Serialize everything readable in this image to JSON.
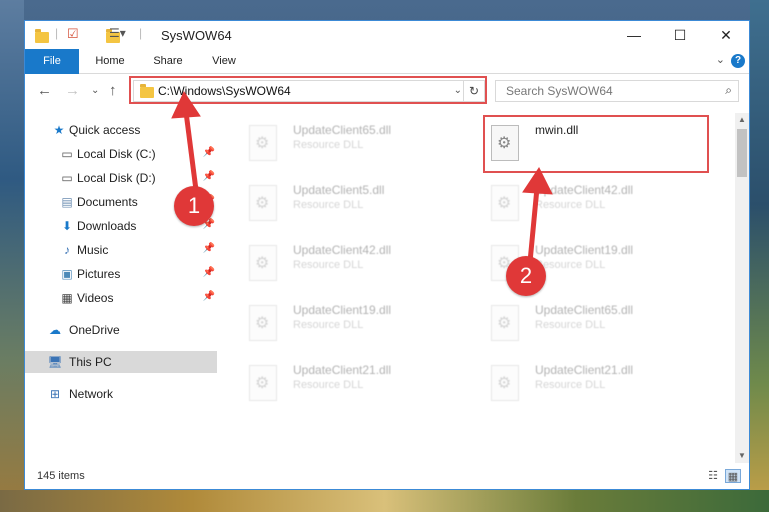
{
  "window": {
    "title": "SysWOW64",
    "controls": {
      "minimize": "—",
      "maximize": "☐",
      "close": "✕"
    }
  },
  "ribbon": {
    "tabs": [
      "File",
      "Home",
      "Share",
      "View"
    ],
    "help": "?"
  },
  "address": {
    "path": "C:\\Windows\\SysWOW64",
    "search_placeholder": "Search SysWOW64"
  },
  "nav": {
    "items": [
      {
        "label": "Quick access",
        "icon": "star-icon"
      },
      {
        "label": "Local Disk (C:)",
        "icon": "drive-icon",
        "pinned": true
      },
      {
        "label": "Local Disk (D:)",
        "icon": "drive-icon",
        "pinned": true
      },
      {
        "label": "Documents",
        "icon": "documents-icon",
        "pinned": true
      },
      {
        "label": "Downloads",
        "icon": "downloads-icon",
        "pinned": true
      },
      {
        "label": "Music",
        "icon": "music-icon",
        "pinned": true
      },
      {
        "label": "Pictures",
        "icon": "pictures-icon",
        "pinned": true
      },
      {
        "label": "Videos",
        "icon": "videos-icon",
        "pinned": true
      },
      {
        "label": "OneDrive",
        "icon": "cloud-icon"
      },
      {
        "label": "This PC",
        "icon": "computer-icon",
        "selected": true
      },
      {
        "label": "Network",
        "icon": "network-icon"
      }
    ]
  },
  "files": [
    {
      "name": "UpdateClient65.dll",
      "desc": "Resource DLL"
    },
    {
      "name": "mwin.dll",
      "desc": ""
    },
    {
      "name": "UpdateClient5.dll",
      "desc": "Resource DLL"
    },
    {
      "name": "UpdateClient42.dll",
      "desc": "Resource DLL"
    },
    {
      "name": "UpdateClient42.dll",
      "desc": "Resource DLL"
    },
    {
      "name": "UpdateClient19.dll",
      "desc": "Resource DLL"
    },
    {
      "name": "UpdateClient19.dll",
      "desc": "Resource DLL"
    },
    {
      "name": "UpdateClient65.dll",
      "desc": "Resource DLL"
    },
    {
      "name": "UpdateClient21.dll",
      "desc": "Resource DLL"
    },
    {
      "name": "UpdateClient21.dll",
      "desc": "Resource DLL"
    }
  ],
  "status": {
    "count": "145 items"
  },
  "annotations": {
    "step1": "1",
    "step2": "2"
  },
  "colors": {
    "accent": "#1979ca",
    "highlight": "#e05050",
    "badge": "#e03838"
  }
}
